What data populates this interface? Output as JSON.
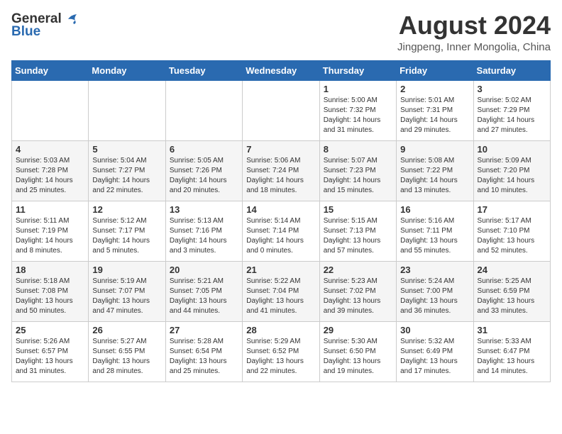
{
  "header": {
    "logo_general": "General",
    "logo_blue": "Blue",
    "month_year": "August 2024",
    "location": "Jingpeng, Inner Mongolia, China"
  },
  "days_of_week": [
    "Sunday",
    "Monday",
    "Tuesday",
    "Wednesday",
    "Thursday",
    "Friday",
    "Saturday"
  ],
  "weeks": [
    [
      {
        "date": "",
        "info": ""
      },
      {
        "date": "",
        "info": ""
      },
      {
        "date": "",
        "info": ""
      },
      {
        "date": "",
        "info": ""
      },
      {
        "date": "1",
        "info": "Sunrise: 5:00 AM\nSunset: 7:32 PM\nDaylight: 14 hours and 31 minutes."
      },
      {
        "date": "2",
        "info": "Sunrise: 5:01 AM\nSunset: 7:31 PM\nDaylight: 14 hours and 29 minutes."
      },
      {
        "date": "3",
        "info": "Sunrise: 5:02 AM\nSunset: 7:29 PM\nDaylight: 14 hours and 27 minutes."
      }
    ],
    [
      {
        "date": "4",
        "info": "Sunrise: 5:03 AM\nSunset: 7:28 PM\nDaylight: 14 hours and 25 minutes."
      },
      {
        "date": "5",
        "info": "Sunrise: 5:04 AM\nSunset: 7:27 PM\nDaylight: 14 hours and 22 minutes."
      },
      {
        "date": "6",
        "info": "Sunrise: 5:05 AM\nSunset: 7:26 PM\nDaylight: 14 hours and 20 minutes."
      },
      {
        "date": "7",
        "info": "Sunrise: 5:06 AM\nSunset: 7:24 PM\nDaylight: 14 hours and 18 minutes."
      },
      {
        "date": "8",
        "info": "Sunrise: 5:07 AM\nSunset: 7:23 PM\nDaylight: 14 hours and 15 minutes."
      },
      {
        "date": "9",
        "info": "Sunrise: 5:08 AM\nSunset: 7:22 PM\nDaylight: 14 hours and 13 minutes."
      },
      {
        "date": "10",
        "info": "Sunrise: 5:09 AM\nSunset: 7:20 PM\nDaylight: 14 hours and 10 minutes."
      }
    ],
    [
      {
        "date": "11",
        "info": "Sunrise: 5:11 AM\nSunset: 7:19 PM\nDaylight: 14 hours and 8 minutes."
      },
      {
        "date": "12",
        "info": "Sunrise: 5:12 AM\nSunset: 7:17 PM\nDaylight: 14 hours and 5 minutes."
      },
      {
        "date": "13",
        "info": "Sunrise: 5:13 AM\nSunset: 7:16 PM\nDaylight: 14 hours and 3 minutes."
      },
      {
        "date": "14",
        "info": "Sunrise: 5:14 AM\nSunset: 7:14 PM\nDaylight: 14 hours and 0 minutes."
      },
      {
        "date": "15",
        "info": "Sunrise: 5:15 AM\nSunset: 7:13 PM\nDaylight: 13 hours and 57 minutes."
      },
      {
        "date": "16",
        "info": "Sunrise: 5:16 AM\nSunset: 7:11 PM\nDaylight: 13 hours and 55 minutes."
      },
      {
        "date": "17",
        "info": "Sunrise: 5:17 AM\nSunset: 7:10 PM\nDaylight: 13 hours and 52 minutes."
      }
    ],
    [
      {
        "date": "18",
        "info": "Sunrise: 5:18 AM\nSunset: 7:08 PM\nDaylight: 13 hours and 50 minutes."
      },
      {
        "date": "19",
        "info": "Sunrise: 5:19 AM\nSunset: 7:07 PM\nDaylight: 13 hours and 47 minutes."
      },
      {
        "date": "20",
        "info": "Sunrise: 5:21 AM\nSunset: 7:05 PM\nDaylight: 13 hours and 44 minutes."
      },
      {
        "date": "21",
        "info": "Sunrise: 5:22 AM\nSunset: 7:04 PM\nDaylight: 13 hours and 41 minutes."
      },
      {
        "date": "22",
        "info": "Sunrise: 5:23 AM\nSunset: 7:02 PM\nDaylight: 13 hours and 39 minutes."
      },
      {
        "date": "23",
        "info": "Sunrise: 5:24 AM\nSunset: 7:00 PM\nDaylight: 13 hours and 36 minutes."
      },
      {
        "date": "24",
        "info": "Sunrise: 5:25 AM\nSunset: 6:59 PM\nDaylight: 13 hours and 33 minutes."
      }
    ],
    [
      {
        "date": "25",
        "info": "Sunrise: 5:26 AM\nSunset: 6:57 PM\nDaylight: 13 hours and 31 minutes."
      },
      {
        "date": "26",
        "info": "Sunrise: 5:27 AM\nSunset: 6:55 PM\nDaylight: 13 hours and 28 minutes."
      },
      {
        "date": "27",
        "info": "Sunrise: 5:28 AM\nSunset: 6:54 PM\nDaylight: 13 hours and 25 minutes."
      },
      {
        "date": "28",
        "info": "Sunrise: 5:29 AM\nSunset: 6:52 PM\nDaylight: 13 hours and 22 minutes."
      },
      {
        "date": "29",
        "info": "Sunrise: 5:30 AM\nSunset: 6:50 PM\nDaylight: 13 hours and 19 minutes."
      },
      {
        "date": "30",
        "info": "Sunrise: 5:32 AM\nSunset: 6:49 PM\nDaylight: 13 hours and 17 minutes."
      },
      {
        "date": "31",
        "info": "Sunrise: 5:33 AM\nSunset: 6:47 PM\nDaylight: 13 hours and 14 minutes."
      }
    ]
  ]
}
